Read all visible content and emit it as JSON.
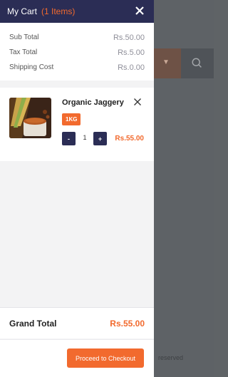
{
  "cart": {
    "title": "My Cart",
    "item_count": "(1 Items)",
    "totals": [
      {
        "label": "Sub Total",
        "value": "Rs.50.00"
      },
      {
        "label": "Tax Total",
        "value": "Rs.5.00"
      },
      {
        "label": "Shipping Cost",
        "value": "Rs.0.00"
      }
    ],
    "items": [
      {
        "name": "Organic Jaggery",
        "variant": "1KG",
        "qty": "1",
        "minus": "-",
        "plus": "+",
        "price": "Rs.55.00"
      }
    ],
    "grand_total_label": "Grand Total",
    "grand_total_value": "Rs.55.00",
    "checkout_label": "Proceed to Checkout"
  },
  "background": {
    "footer_fragment": "reserved"
  },
  "colors": {
    "header": "#2b2d55",
    "accent": "#f26a2e",
    "overlay": "#5e6266"
  },
  "icons": [
    "close-icon",
    "remove-item-icon",
    "search-icon",
    "caret-down-icon"
  ]
}
